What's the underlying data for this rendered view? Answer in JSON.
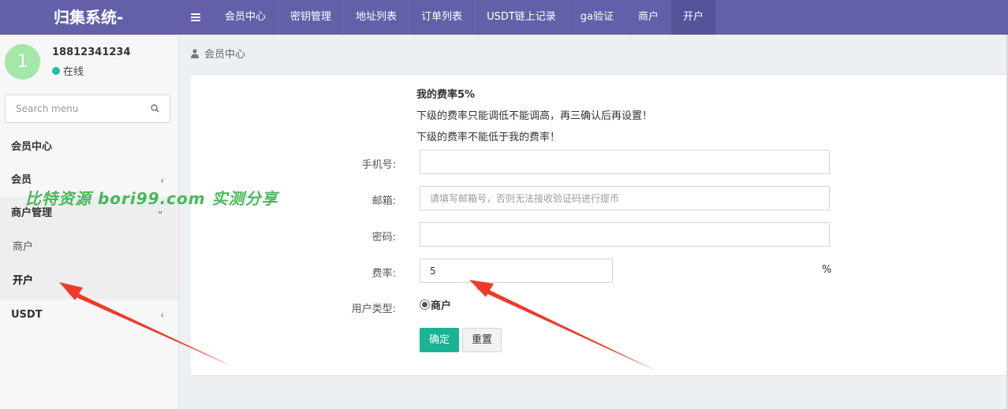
{
  "app": {
    "brand": "归集系统-"
  },
  "nav": {
    "items": [
      {
        "label": "会员中心"
      },
      {
        "label": "密钥管理"
      },
      {
        "label": "地址列表"
      },
      {
        "label": "订单列表"
      },
      {
        "label": "USDT链上记录"
      },
      {
        "label": "ga验证"
      },
      {
        "label": "商户"
      },
      {
        "label": "开户"
      }
    ],
    "active": "开户"
  },
  "user": {
    "avatar_text": "1",
    "phone": "18812341234",
    "status": "在线"
  },
  "sidebar": {
    "search_placeholder": "Search menu",
    "items": [
      {
        "label": "会员中心"
      },
      {
        "label": "会员",
        "chevron": "‹"
      },
      {
        "label": "商户管理",
        "chevron": "⌄"
      },
      {
        "label": "USDT",
        "chevron": "‹"
      }
    ],
    "submenu": [
      {
        "label": "商户"
      },
      {
        "label": "开户"
      }
    ]
  },
  "watermark": "比特资源 bori99.com 实测分享",
  "breadcrumb": {
    "label": "会员中心"
  },
  "form": {
    "notes": [
      "我的费率5%",
      "下级的费率只能调低不能调高，再三确认后再设置！",
      "下级的费率不能低于我的费率！"
    ],
    "phone_label": "手机号:",
    "phone_value": "",
    "email_label": "邮箱:",
    "email_placeholder": "请填写邮箱号，否则无法接收验证码进行提币",
    "password_label": "密码:",
    "rate_label": "费率:",
    "rate_value": "5",
    "rate_unit": "%",
    "type_label": "用户类型:",
    "type_option": "商户",
    "submit_label": "确定",
    "reset_label": "重置"
  },
  "colors": {
    "topbar": "#6360a9",
    "accent": "#1ab394",
    "online": "#1ec0a0",
    "watermark": "#34b34a",
    "arrow": "#ee3a2a"
  }
}
